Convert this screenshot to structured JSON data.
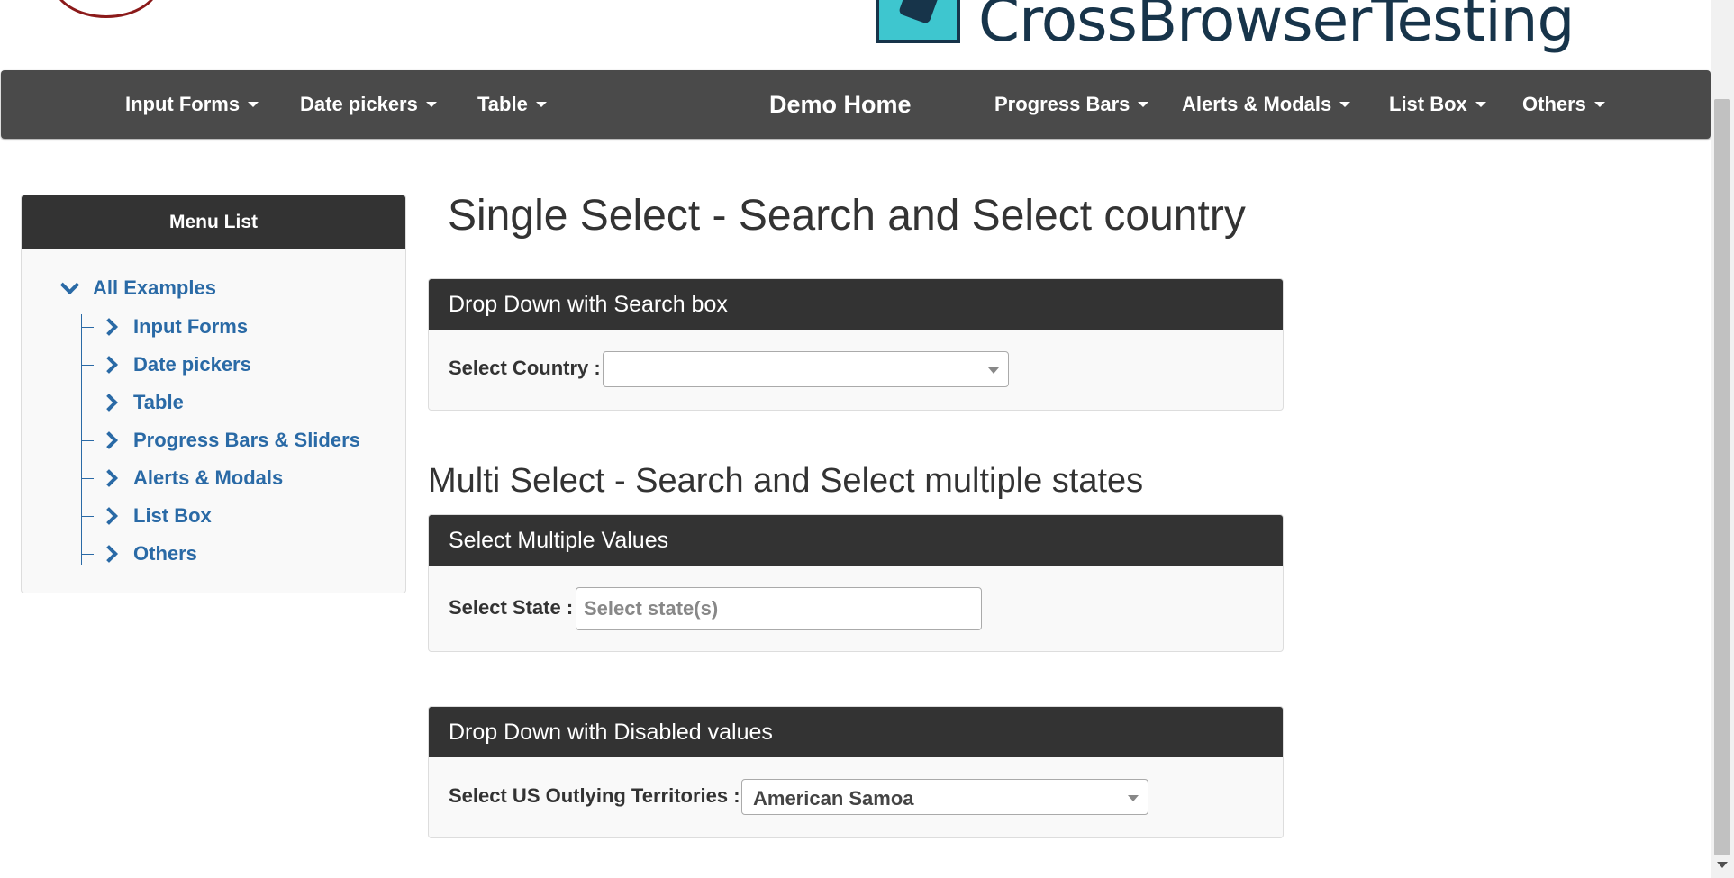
{
  "header": {
    "brand_text": "CrossBrowserTesting",
    "brand_colors": {
      "box": "#3ec6cf",
      "text": "#17344a"
    }
  },
  "navbar": {
    "items_left": [
      "Input Forms",
      "Date pickers",
      "Table"
    ],
    "home": "Demo Home",
    "items_right": [
      "Progress Bars",
      "Alerts & Modals",
      "List Box",
      "Others"
    ]
  },
  "sidebar": {
    "title": "Menu List",
    "root": "All Examples",
    "items": [
      "Input Forms",
      "Date pickers",
      "Table",
      "Progress Bars & Sliders",
      "Alerts & Modals",
      "List Box",
      "Others"
    ]
  },
  "main": {
    "single_title": "Single Select - Search and Select country",
    "panel1": {
      "heading": "Drop Down with Search box",
      "label": "Select Country :",
      "value": ""
    },
    "multi_title": "Multi Select - Search and Select multiple states",
    "panel2": {
      "heading": "Select Multiple Values",
      "label": "Select State :",
      "placeholder": "Select state(s)"
    },
    "panel3": {
      "heading": "Drop Down with Disabled values",
      "label": "Select US Outlying Territories :",
      "value": "American Samoa"
    }
  },
  "icons": [
    "caret-down-icon",
    "chevron-down-icon",
    "chevron-right-icon",
    "dropdown-arrow-icon"
  ]
}
